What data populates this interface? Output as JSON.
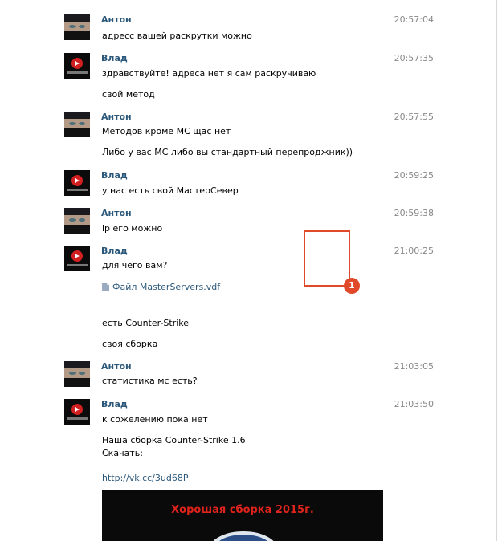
{
  "messages": [
    {
      "author": "Антон",
      "time": "20:57:04",
      "avatar": "anton"
    },
    {
      "author": "Влад",
      "time": "20:57:35",
      "avatar": "vlad"
    },
    {
      "author": "Антон",
      "time": "20:57:55",
      "avatar": "anton"
    },
    {
      "author": "Влад",
      "time": "20:59:25",
      "avatar": "vlad"
    },
    {
      "author": "Антон",
      "time": "20:59:38",
      "avatar": "anton"
    },
    {
      "author": "Влад",
      "time": "21:00:25",
      "avatar": "vlad"
    },
    {
      "author": "Антон",
      "time": "21:03:05",
      "avatar": "anton"
    },
    {
      "author": "Влад",
      "time": "21:03:50",
      "avatar": "vlad"
    }
  ],
  "lines": [
    "адресс вашей раскрутки можно",
    "здравствуйте! адреса нет я сам раскручиваю",
    "свой метод",
    "Методов кроме МС щас нет",
    "Либо у вас МС либо вы стандартный перепроджник))",
    "у нас есть свой МастерСевер",
    "ip его можно",
    "для чего вам?",
    "есть Counter-Strike",
    "своя сборка",
    "статистика мс есть?",
    "к сожелению пока нет",
    "Наша сборка Counter-Strike 1.6",
    "Скачать:"
  ],
  "attachment": {
    "label": "Файл MasterServers.vdf",
    "icon": "document-icon"
  },
  "link": "http://vk.cc/3ud68P",
  "banner": {
    "title": "Хорошая сборка 2015г."
  },
  "annotation": {
    "badge": "1",
    "color": "#e04a2a"
  },
  "colors": {
    "name": "#2b587a",
    "time": "#888888",
    "link": "#2b587a"
  }
}
